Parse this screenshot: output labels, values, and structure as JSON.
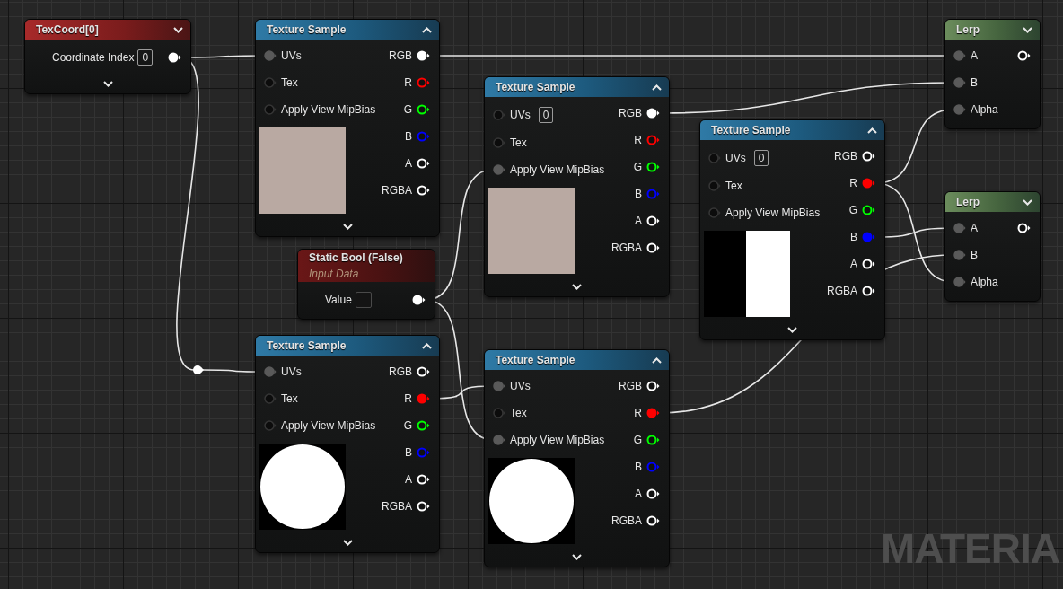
{
  "nodes": [
    {
      "kind": "texcoord",
      "title": "TexCoord[0]",
      "expanded": false,
      "has_advanced_pins": true,
      "inputs": [
        {
          "label": "Coordinate Index",
          "value": "0"
        }
      ],
      "outputs": [
        {
          "connected": true,
          "color": "#ffffff"
        }
      ]
    },
    {
      "kind": "texture_sample",
      "title": "Texture Sample",
      "expanded": true,
      "has_advanced_pins": true,
      "preview": {
        "kind": "flat"
      },
      "inputs": [
        {
          "label": "UVs",
          "connected": true
        },
        {
          "label": "Tex",
          "connected": false
        },
        {
          "label": "Apply View MipBias",
          "connected": false
        }
      ],
      "outputs": [
        {
          "label": "RGB",
          "connected": true,
          "color": "#ffffff"
        },
        {
          "label": "R",
          "connected": false,
          "color": "#ff0000"
        },
        {
          "label": "G",
          "connected": false,
          "color": "#00ff00"
        },
        {
          "label": "B",
          "connected": false,
          "color": "#0000ff"
        },
        {
          "label": "A",
          "connected": false,
          "color": "#ffffff"
        },
        {
          "label": "RGBA",
          "connected": false,
          "color": "#ffffff"
        }
      ]
    },
    {
      "kind": "texture_sample",
      "title": "Texture Sample",
      "expanded": true,
      "has_advanced_pins": true,
      "preview": {
        "kind": "flat"
      },
      "inputs": [
        {
          "label": "UVs",
          "value": "0",
          "connected": false
        },
        {
          "label": "Tex",
          "connected": false
        },
        {
          "label": "Apply View MipBias",
          "connected": true
        }
      ],
      "outputs": [
        {
          "label": "RGB",
          "connected": true,
          "color": "#ffffff"
        },
        {
          "label": "R",
          "connected": false,
          "color": "#ff0000"
        },
        {
          "label": "G",
          "connected": false,
          "color": "#00ff00"
        },
        {
          "label": "B",
          "connected": false,
          "color": "#0000ff"
        },
        {
          "label": "A",
          "connected": false,
          "color": "#ffffff"
        },
        {
          "label": "RGBA",
          "connected": false,
          "color": "#ffffff"
        }
      ]
    },
    {
      "kind": "texture_sample",
      "title": "Texture Sample",
      "expanded": true,
      "has_advanced_pins": true,
      "preview": {
        "kind": "split"
      },
      "inputs": [
        {
          "label": "UVs",
          "value": "0",
          "connected": false
        },
        {
          "label": "Tex",
          "connected": false
        },
        {
          "label": "Apply View MipBias",
          "connected": false
        }
      ],
      "outputs": [
        {
          "label": "RGB",
          "connected": false,
          "color": "#ffffff"
        },
        {
          "label": "R",
          "connected": true,
          "color": "#ff0000"
        },
        {
          "label": "G",
          "connected": false,
          "color": "#00ff00"
        },
        {
          "label": "B",
          "connected": true,
          "color": "#0000ff"
        },
        {
          "label": "A",
          "connected": false,
          "color": "#ffffff"
        },
        {
          "label": "RGBA",
          "connected": false,
          "color": "#ffffff"
        }
      ]
    },
    {
      "kind": "static_bool",
      "title": "Static Bool (False)",
      "subtitle": "Input Data",
      "inputs": [
        {
          "label": "Value",
          "checked": false
        }
      ],
      "outputs": [
        {
          "connected": true,
          "color": "#ffffff"
        }
      ]
    },
    {
      "kind": "texture_sample",
      "title": "Texture Sample",
      "expanded": true,
      "has_advanced_pins": true,
      "preview": {
        "kind": "disc"
      },
      "inputs": [
        {
          "label": "UVs",
          "connected": true
        },
        {
          "label": "Tex",
          "connected": false
        },
        {
          "label": "Apply View MipBias",
          "connected": false
        }
      ],
      "outputs": [
        {
          "label": "RGB",
          "connected": false,
          "color": "#ffffff"
        },
        {
          "label": "R",
          "connected": true,
          "color": "#ff0000"
        },
        {
          "label": "G",
          "connected": false,
          "color": "#00ff00"
        },
        {
          "label": "B",
          "connected": false,
          "color": "#0000ff"
        },
        {
          "label": "A",
          "connected": false,
          "color": "#ffffff"
        },
        {
          "label": "RGBA",
          "connected": false,
          "color": "#ffffff"
        }
      ]
    },
    {
      "kind": "texture_sample",
      "title": "Texture Sample",
      "expanded": true,
      "has_advanced_pins": true,
      "preview": {
        "kind": "disc"
      },
      "inputs": [
        {
          "label": "UVs",
          "connected": true
        },
        {
          "label": "Tex",
          "connected": false
        },
        {
          "label": "Apply View MipBias",
          "connected": true
        }
      ],
      "outputs": [
        {
          "label": "RGB",
          "connected": false,
          "color": "#ffffff"
        },
        {
          "label": "R",
          "connected": true,
          "color": "#ff0000"
        },
        {
          "label": "G",
          "connected": false,
          "color": "#00ff00"
        },
        {
          "label": "B",
          "connected": false,
          "color": "#0000ff"
        },
        {
          "label": "A",
          "connected": false,
          "color": "#ffffff"
        },
        {
          "label": "RGBA",
          "connected": false,
          "color": "#ffffff"
        }
      ]
    },
    {
      "kind": "lerp",
      "title": "Lerp",
      "expanded": false,
      "inputs": [
        {
          "label": "A",
          "connected": true
        },
        {
          "label": "B",
          "connected": true
        },
        {
          "label": "Alpha",
          "connected": true
        }
      ],
      "outputs": [
        {
          "connected": false,
          "color": "#ffffff"
        }
      ]
    },
    {
      "kind": "lerp",
      "title": "Lerp",
      "expanded": false,
      "inputs": [
        {
          "label": "A",
          "connected": true
        },
        {
          "label": "B",
          "connected": true
        },
        {
          "label": "Alpha",
          "connected": true
        }
      ],
      "outputs": [
        {
          "connected": false,
          "color": "#ffffff"
        }
      ]
    }
  ],
  "graph_label": "MATERIA"
}
